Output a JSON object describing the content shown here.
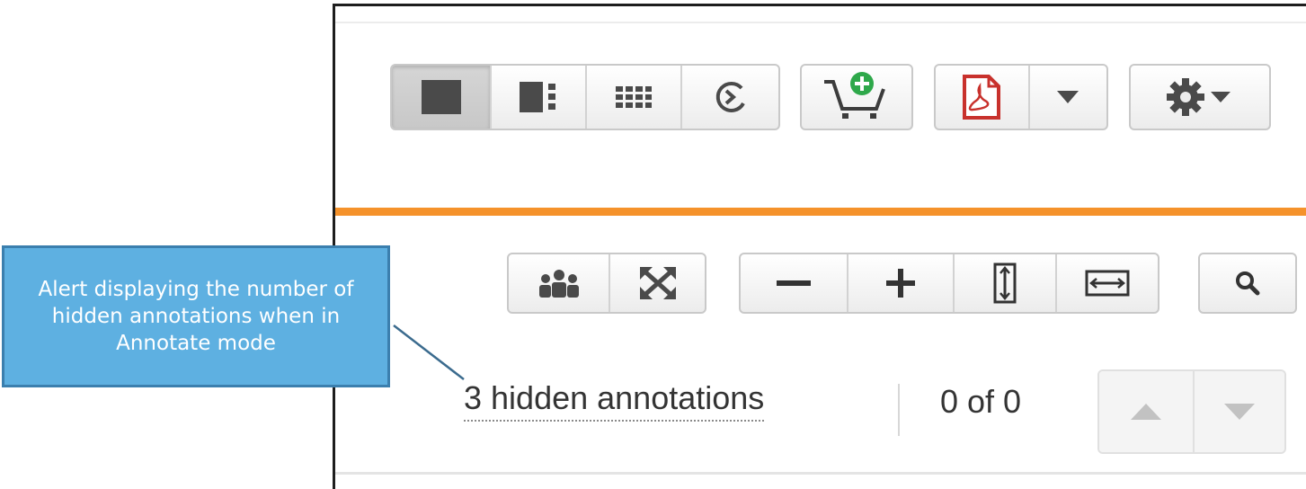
{
  "toolbar_top": {
    "view_modes": [
      {
        "name": "single-page-view-icon",
        "active": true
      },
      {
        "name": "page-with-thumbnails-view-icon",
        "active": false
      },
      {
        "name": "thumbnail-grid-view-icon",
        "active": false
      },
      {
        "name": "history-icon",
        "active": false
      }
    ],
    "add_to_cart_icon": "cart-add-icon",
    "pdf_icon": "pdf-icon",
    "pdf_dropdown_icon": "caret-down-icon",
    "settings_icon": "gear-icon"
  },
  "toolbar_view": {
    "annotate_icon": "users-icon",
    "fullscreen_icon": "expand-icon",
    "zoom_out_icon": "minus-icon",
    "zoom_in_icon": "plus-icon",
    "fit_height_icon": "fit-height-icon",
    "fit_width_icon": "fit-width-icon",
    "search_icon": "search-icon"
  },
  "status": {
    "hidden_annotations": "3 hidden annotations",
    "match_count": "0 of 0",
    "prev_icon": "arrow-up-icon",
    "next_icon": "arrow-down-icon"
  },
  "callout": {
    "text": "Alert displaying the number of hidden annotations when in Annotate mode"
  },
  "colors": {
    "accent_orange": "#f5922b",
    "pdf_red": "#c8312c",
    "cart_green": "#2ea84a",
    "callout_blue": "#5eb0e1"
  }
}
